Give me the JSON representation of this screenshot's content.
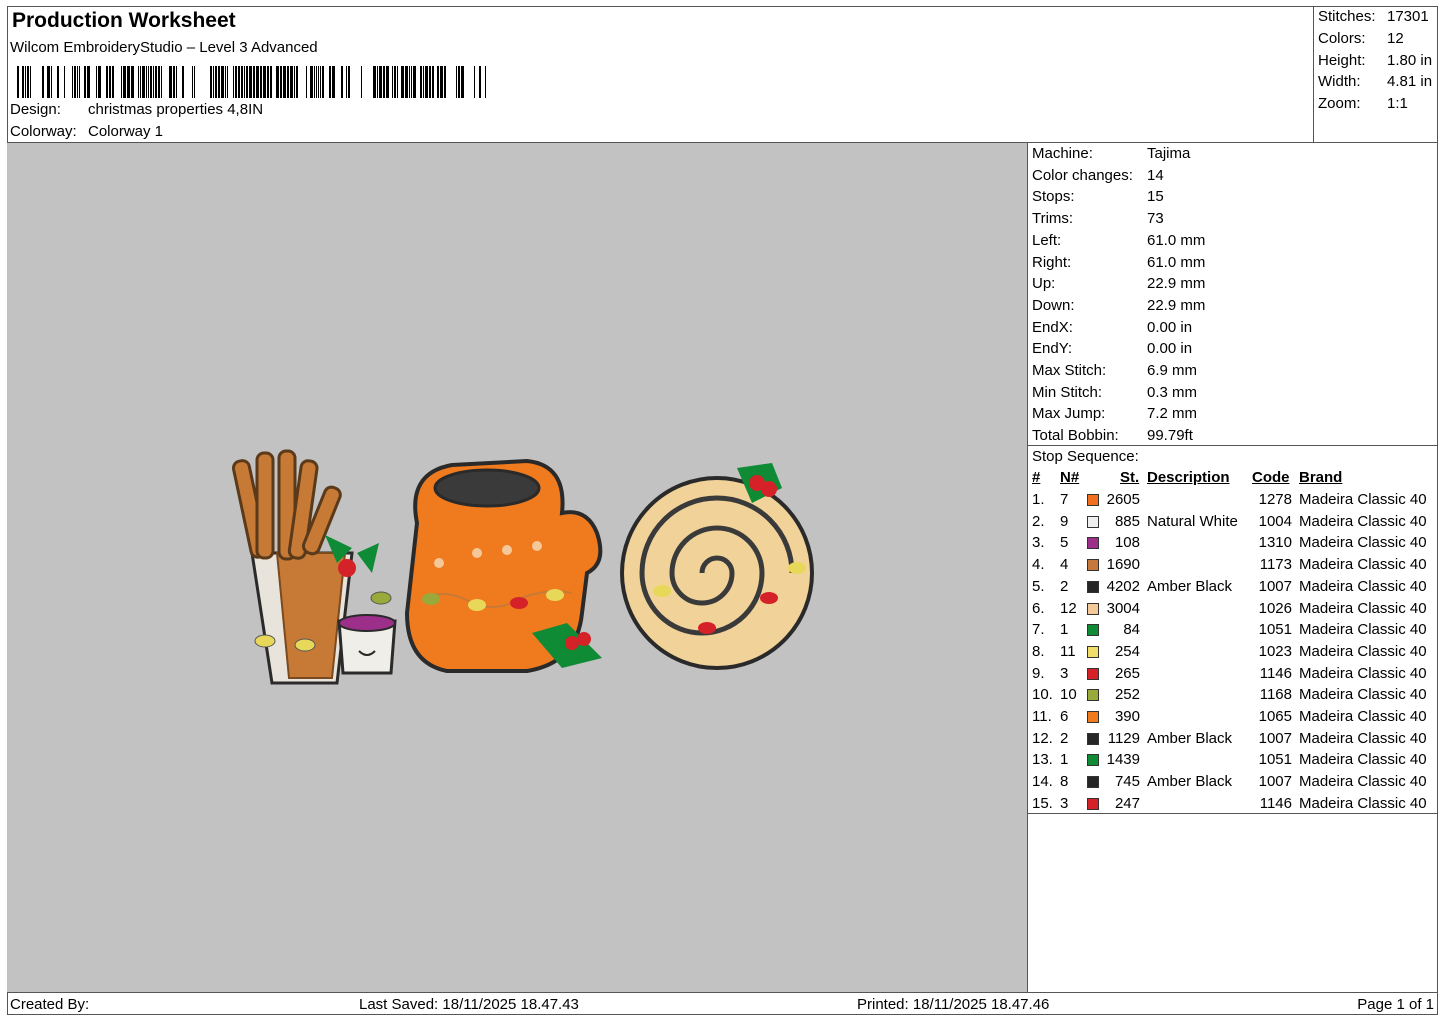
{
  "header": {
    "title": "Production Worksheet",
    "software": "Wilcom EmbroideryStudio – Level 3 Advanced",
    "design_label": "Design:",
    "design_value": "christmas properties 4,8IN",
    "colorway_label": "Colorway:",
    "colorway_value": "Colorway 1"
  },
  "summary": [
    {
      "label": "Stitches:",
      "value": "17301"
    },
    {
      "label": "Colors:",
      "value": "12"
    },
    {
      "label": "Height:",
      "value": "1.80 in"
    },
    {
      "label": "Width:",
      "value": "4.81 in"
    },
    {
      "label": "Zoom:",
      "value": "1:1"
    }
  ],
  "machine_info": [
    {
      "label": "Machine:",
      "value": "Tajima"
    },
    {
      "label": "Color changes:",
      "value": "14"
    },
    {
      "label": "Stops:",
      "value": "15"
    },
    {
      "label": "Trims:",
      "value": "73"
    },
    {
      "label": "Left:",
      "value": "61.0 mm"
    },
    {
      "label": "Right:",
      "value": "61.0 mm"
    },
    {
      "label": "Up:",
      "value": "22.9 mm"
    },
    {
      "label": "Down:",
      "value": "22.9 mm"
    },
    {
      "label": "EndX:",
      "value": "0.00 in"
    },
    {
      "label": "EndY:",
      "value": "0.00 in"
    },
    {
      "label": "Max Stitch:",
      "value": "6.9 mm"
    },
    {
      "label": "Min Stitch:",
      "value": "0.3 mm"
    },
    {
      "label": "Max Jump:",
      "value": "7.2 mm"
    },
    {
      "label": "Total Bobbin:",
      "value": "99.79ft"
    }
  ],
  "stop_sequence": {
    "title": "Stop Sequence:",
    "columns": [
      "#",
      "N#",
      "St.",
      "Description",
      "Code",
      "Brand"
    ],
    "rows": [
      {
        "idx": "1.",
        "n": "7",
        "color": "#f07020",
        "st": "2605",
        "desc": "",
        "code": "1278",
        "brand": "Madeira Classic 40"
      },
      {
        "idx": "2.",
        "n": "9",
        "color": "#efefef",
        "st": "885",
        "desc": "Natural White",
        "code": "1004",
        "brand": "Madeira Classic 40"
      },
      {
        "idx": "3.",
        "n": "5",
        "color": "#9b2f8a",
        "st": "108",
        "desc": "",
        "code": "1310",
        "brand": "Madeira Classic 40"
      },
      {
        "idx": "4.",
        "n": "4",
        "color": "#c57a3c",
        "st": "1690",
        "desc": "",
        "code": "1173",
        "brand": "Madeira Classic 40"
      },
      {
        "idx": "5.",
        "n": "2",
        "color": "#262626",
        "st": "4202",
        "desc": "Amber Black",
        "code": "1007",
        "brand": "Madeira Classic 40"
      },
      {
        "idx": "6.",
        "n": "12",
        "color": "#f5c89a",
        "st": "3004",
        "desc": "",
        "code": "1026",
        "brand": "Madeira Classic 40"
      },
      {
        "idx": "7.",
        "n": "1",
        "color": "#0f8a35",
        "st": "84",
        "desc": "",
        "code": "1051",
        "brand": "Madeira Classic 40"
      },
      {
        "idx": "8.",
        "n": "11",
        "color": "#f3dd6a",
        "st": "254",
        "desc": "",
        "code": "1023",
        "brand": "Madeira Classic 40"
      },
      {
        "idx": "9.",
        "n": "3",
        "color": "#d42228",
        "st": "265",
        "desc": "",
        "code": "1146",
        "brand": "Madeira Classic 40"
      },
      {
        "idx": "10.",
        "n": "10",
        "color": "#9aaa3a",
        "st": "252",
        "desc": "",
        "code": "1168",
        "brand": "Madeira Classic 40"
      },
      {
        "idx": "11.",
        "n": "6",
        "color": "#f07a1e",
        "st": "390",
        "desc": "",
        "code": "1065",
        "brand": "Madeira Classic 40"
      },
      {
        "idx": "12.",
        "n": "2",
        "color": "#262626",
        "st": "1129",
        "desc": "Amber Black",
        "code": "1007",
        "brand": "Madeira Classic 40"
      },
      {
        "idx": "13.",
        "n": "1",
        "color": "#0f8a35",
        "st": "1439",
        "desc": "",
        "code": "1051",
        "brand": "Madeira Classic 40"
      },
      {
        "idx": "14.",
        "n": "8",
        "color": "#262626",
        "st": "745",
        "desc": "Amber Black",
        "code": "1007",
        "brand": "Madeira Classic 40"
      },
      {
        "idx": "15.",
        "n": "3",
        "color": "#d42228",
        "st": "247",
        "desc": "",
        "code": "1146",
        "brand": "Madeira Classic 40"
      }
    ]
  },
  "footer": {
    "created_by": "Created By:",
    "last_saved": "Last Saved: 18/11/2025 18.47.43",
    "printed": "Printed: 18/11/2025 18.47.46",
    "page": "Page 1 of 1"
  },
  "preview": {
    "background": "#c2c2c2"
  }
}
